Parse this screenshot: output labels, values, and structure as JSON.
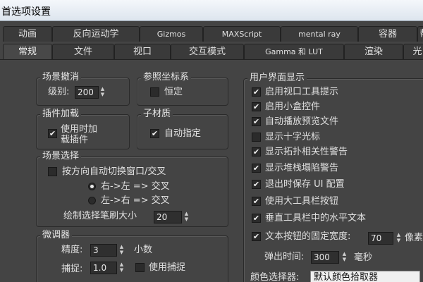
{
  "window": {
    "title": "首选项设置"
  },
  "tabs_row1": [
    "动画",
    "反向运动学",
    "Gizmos",
    "MAXScript",
    "mental ray",
    "容器",
    "帮"
  ],
  "tabs_row2": [
    "常规",
    "文件",
    "视口",
    "交互模式",
    "Gamma 和 LUT",
    "渲染",
    "光"
  ],
  "scene_undo": {
    "title": "场景撤消",
    "levels_label": "级别:",
    "levels_value": "200"
  },
  "ref_coord": {
    "title": "参照坐标系",
    "constant_label": "恒定",
    "constant_checked": false
  },
  "plugin_load": {
    "title": "插件加载",
    "load_on_use_label": "使用时加\n载插件",
    "load_on_use_checked": true
  },
  "sub_material": {
    "title": "子材质",
    "auto_assign_label": "自动指定",
    "auto_assign_checked": true
  },
  "scene_select": {
    "title": "场景选择",
    "auto_window_cross_label": "按方向自动切换窗口/交叉",
    "auto_window_cross_checked": false,
    "r2l_label": "右->左 => 交叉",
    "r2l_selected": true,
    "l2r_label": "左->右 => 交叉",
    "l2r_selected": false,
    "brush_size_label": "绘制选择笔刷大小",
    "brush_size_value": "20"
  },
  "spinners": {
    "title": "微调器",
    "precision_label": "精度:",
    "precision_value": "3",
    "precision_unit": "小数",
    "snap_label": "捕捉:",
    "snap_value": "1.0",
    "use_snap_label": "使用捕捉",
    "use_snap_checked": false
  },
  "ui_display": {
    "title": "用户界面显示",
    "options": [
      {
        "label": "启用视口工具提示",
        "checked": true
      },
      {
        "label": "启用小盒控件",
        "checked": true
      },
      {
        "label": "自动播放预览文件",
        "checked": true
      },
      {
        "label": "显示十字光标",
        "checked": false
      },
      {
        "label": "显示拓扑相关性警告",
        "checked": true
      },
      {
        "label": "显示堆栈塌陷警告",
        "checked": true
      },
      {
        "label": "退出时保存 UI 配置",
        "checked": true
      },
      {
        "label": "使用大工具栏按钮",
        "checked": true
      },
      {
        "label": "垂直工具栏中的水平文本",
        "checked": true
      }
    ],
    "fixed_width_label": "文本按钮的固定宽度:",
    "fixed_width_checked": true,
    "fixed_width_value": "70",
    "fixed_width_unit": "像素",
    "flyout_label": "弹出时间:",
    "flyout_value": "300",
    "flyout_unit": "毫秒",
    "color_picker_label": "颜色选择器:",
    "color_picker_value": "默认颜色拾取器"
  }
}
